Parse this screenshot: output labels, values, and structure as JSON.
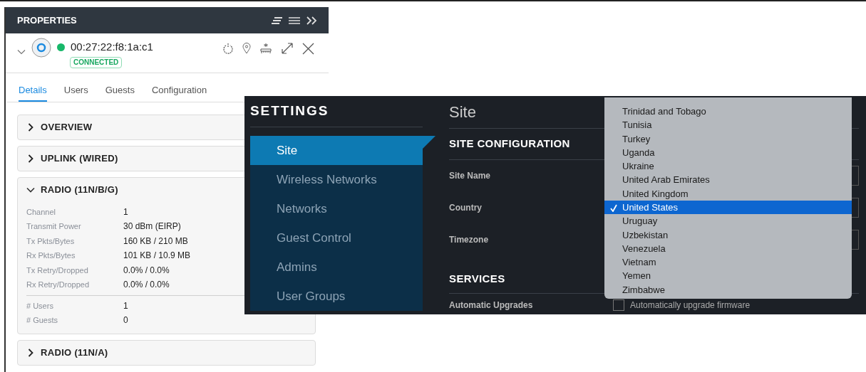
{
  "properties_panel": {
    "title": "PROPERTIES",
    "device": {
      "mac": "00:27:22:f8:1a:c1",
      "status": "CONNECTED",
      "online": true
    },
    "tabs": [
      {
        "label": "Details",
        "selected": true
      },
      {
        "label": "Users",
        "selected": false
      },
      {
        "label": "Guests",
        "selected": false
      },
      {
        "label": "Configuration",
        "selected": false
      }
    ],
    "sections": [
      {
        "title": "OVERVIEW",
        "expanded": false
      },
      {
        "title": "UPLINK (WIRED)",
        "expanded": false
      },
      {
        "title": "RADIO (11N/B/G)",
        "expanded": true,
        "groups": [
          [
            {
              "label": "Channel",
              "value": "1"
            },
            {
              "label": "Transmit Power",
              "value": "30 dBm (EIRP)"
            },
            {
              "label": "Tx Pkts/Bytes",
              "value": "160 KB / 210 MB"
            },
            {
              "label": "Rx Pkts/Bytes",
              "value": "101 KB / 10.9 MB"
            },
            {
              "label": "Tx Retry/Dropped",
              "value": "0.0% / 0.0%"
            },
            {
              "label": "Rx Retry/Dropped",
              "value": "0.0% / 0.0%"
            }
          ],
          [
            {
              "label": "# Users",
              "value": "1"
            },
            {
              "label": "# Guests",
              "value": "0"
            }
          ]
        ]
      },
      {
        "title": "RADIO (11N/A)",
        "expanded": false
      }
    ]
  },
  "settings": {
    "title": "SETTINGS",
    "nav": [
      {
        "label": "Site",
        "selected": true
      },
      {
        "label": "Wireless Networks",
        "selected": false
      },
      {
        "label": "Networks",
        "selected": false
      },
      {
        "label": "Guest Control",
        "selected": false
      },
      {
        "label": "Admins",
        "selected": false
      },
      {
        "label": "User Groups",
        "selected": false
      }
    ],
    "page_title": "Site",
    "section_1": "SITE CONFIGURATION",
    "fields": [
      "Site Name",
      "Country",
      "Timezone"
    ],
    "section_2": "SERVICES",
    "service_label": "Automatic Upgrades",
    "service_checkbox": {
      "label": "Automatically upgrade firmware",
      "checked": false
    },
    "country_options": [
      {
        "label": "Trinidad and Tobago",
        "selected": false
      },
      {
        "label": "Tunisia",
        "selected": false
      },
      {
        "label": "Turkey",
        "selected": false
      },
      {
        "label": "Uganda",
        "selected": false
      },
      {
        "label": "Ukraine",
        "selected": false
      },
      {
        "label": "United Arab Emirates",
        "selected": false
      },
      {
        "label": "United Kingdom",
        "selected": false
      },
      {
        "label": "United States",
        "selected": true
      },
      {
        "label": "Uruguay",
        "selected": false
      },
      {
        "label": "Uzbekistan",
        "selected": false
      },
      {
        "label": "Venezuela",
        "selected": false
      },
      {
        "label": "Vietnam",
        "selected": false
      },
      {
        "label": "Yemen",
        "selected": false
      },
      {
        "label": "Zimbabwe",
        "selected": false
      }
    ]
  }
}
